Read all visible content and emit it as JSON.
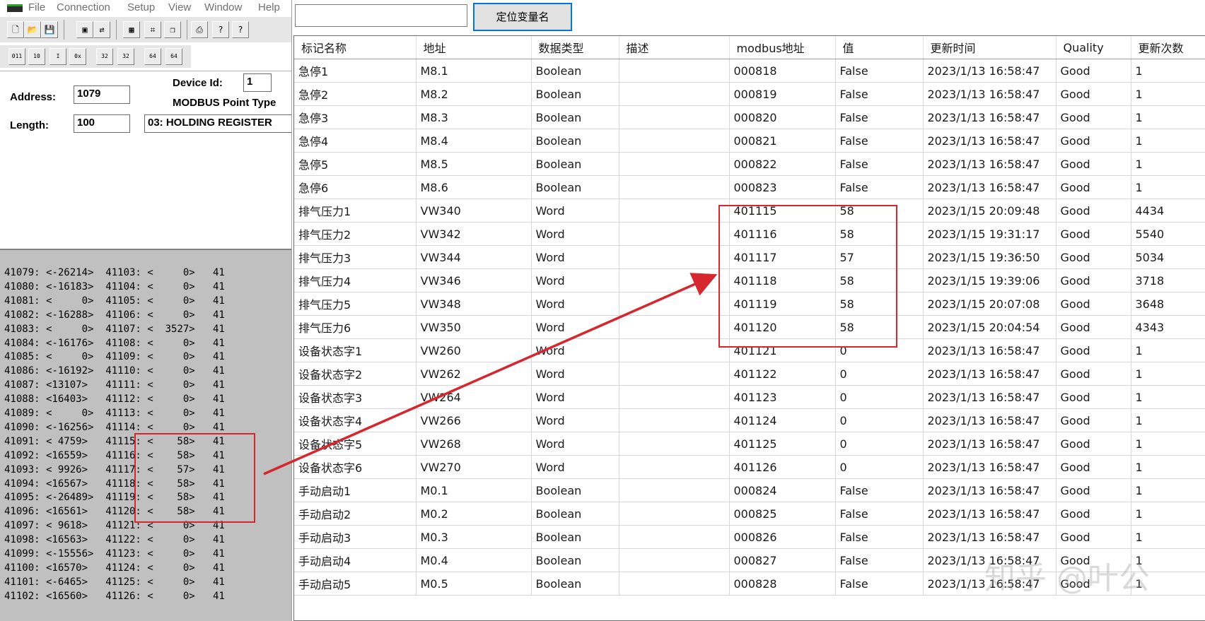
{
  "left_window": {
    "menu": [
      "File",
      "Connection",
      "Setup",
      "View",
      "Window",
      "Help"
    ],
    "toolbar1_icons": [
      {
        "name": "new-file-icon",
        "glyph": "🗋"
      },
      {
        "name": "open-folder-icon",
        "glyph": "📂"
      },
      {
        "name": "save-icon",
        "glyph": "💾"
      },
      {
        "name": "connect-icon",
        "glyph": "▣"
      },
      {
        "name": "disconnect-icon",
        "glyph": "⇄"
      },
      {
        "name": "display-options-icon",
        "glyph": "▦"
      },
      {
        "name": "data-view-icon",
        "glyph": "⌗"
      },
      {
        "name": "tile-windows-icon",
        "glyph": "❐"
      },
      {
        "name": "print-icon",
        "glyph": "⎙"
      },
      {
        "name": "help-icon",
        "glyph": "?"
      },
      {
        "name": "context-help-icon",
        "glyph": "?"
      }
    ],
    "toolbar2_icons": [
      {
        "name": "binary-format-icon",
        "glyph": "011"
      },
      {
        "name": "decimal-format-icon",
        "glyph": "10"
      },
      {
        "name": "integer-format-icon",
        "glyph": "I"
      },
      {
        "name": "hex-format-icon",
        "glyph": "0x"
      },
      {
        "name": "float-format-icon",
        "glyph": "32"
      },
      {
        "name": "reverse-float-icon",
        "glyph": "32"
      },
      {
        "name": "double-format-icon",
        "glyph": "64"
      },
      {
        "name": "reverse-double-icon",
        "glyph": "64"
      }
    ],
    "config": {
      "device_id_label": "Device Id:",
      "device_id": "1",
      "point_type_label": "MODBUS Point Type",
      "address_label": "Address:",
      "address": "1079",
      "length_label": "Length:",
      "length": "100",
      "point_type": "03: HOLDING REGISTER"
    },
    "registers": [
      "41079: <-26214>  41103: <     0>   41",
      "41080: <-16183>  41104: <     0>   41",
      "41081: <     0>  41105: <     0>   41",
      "41082: <-16288>  41106: <     0>   41",
      "41083: <     0>  41107: <  3527>   41",
      "41084: <-16176>  41108: <     0>   41",
      "41085: <     0>  41109: <     0>   41",
      "41086: <-16192>  41110: <     0>   41",
      "41087: <13107>   41111: <     0>   41",
      "41088: <16403>   41112: <     0>   41",
      "41089: <     0>  41113: <     0>   41",
      "41090: <-16256>  41114: <     0>   41",
      "41091: < 4759>   41115: <    58>   41",
      "41092: <16559>   41116: <    58>   41",
      "41093: < 9926>   41117: <    57>   41",
      "41094: <16567>   41118: <    58>   41",
      "41095: <-26489>  41119: <    58>   41",
      "41096: <16561>   41120: <    58>   41",
      "41097: < 9618>   41121: <     0>   41",
      "41098: <16563>   41122: <     0>   41",
      "41099: <-15556>  41123: <     0>   41",
      "41100: <16570>   41124: <     0>   41",
      "41101: <-6465>   41125: <     0>   41",
      "41102: <16560>   41126: <     0>   41"
    ]
  },
  "right_window": {
    "search_value": "",
    "locate_button_label": "定位变量名",
    "columns": [
      "标记名称",
      "地址",
      "数据类型",
      "描述",
      "modbus地址",
      "值",
      "更新时间",
      "Quality",
      "更新次数"
    ],
    "rows": [
      [
        "急停1",
        "M8.1",
        "Boolean",
        "",
        "000818",
        "False",
        "2023/1/13 16:58:47",
        "Good",
        "1"
      ],
      [
        "急停2",
        "M8.2",
        "Boolean",
        "",
        "000819",
        "False",
        "2023/1/13 16:58:47",
        "Good",
        "1"
      ],
      [
        "急停3",
        "M8.3",
        "Boolean",
        "",
        "000820",
        "False",
        "2023/1/13 16:58:47",
        "Good",
        "1"
      ],
      [
        "急停4",
        "M8.4",
        "Boolean",
        "",
        "000821",
        "False",
        "2023/1/13 16:58:47",
        "Good",
        "1"
      ],
      [
        "急停5",
        "M8.5",
        "Boolean",
        "",
        "000822",
        "False",
        "2023/1/13 16:58:47",
        "Good",
        "1"
      ],
      [
        "急停6",
        "M8.6",
        "Boolean",
        "",
        "000823",
        "False",
        "2023/1/13 16:58:47",
        "Good",
        "1"
      ],
      [
        "排气压力1",
        "VW340",
        "Word",
        "",
        "401115",
        "58",
        "2023/1/15 20:09:48",
        "Good",
        "4434"
      ],
      [
        "排气压力2",
        "VW342",
        "Word",
        "",
        "401116",
        "58",
        "2023/1/15 19:31:17",
        "Good",
        "5540"
      ],
      [
        "排气压力3",
        "VW344",
        "Word",
        "",
        "401117",
        "57",
        "2023/1/15 19:36:50",
        "Good",
        "5034"
      ],
      [
        "排气压力4",
        "VW346",
        "Word",
        "",
        "401118",
        "58",
        "2023/1/15 19:39:06",
        "Good",
        "3718"
      ],
      [
        "排气压力5",
        "VW348",
        "Word",
        "",
        "401119",
        "58",
        "2023/1/15 20:07:08",
        "Good",
        "3648"
      ],
      [
        "排气压力6",
        "VW350",
        "Word",
        "",
        "401120",
        "58",
        "2023/1/15 20:04:54",
        "Good",
        "4343"
      ],
      [
        "设备状态字1",
        "VW260",
        "Word",
        "",
        "401121",
        "0",
        "2023/1/13 16:58:47",
        "Good",
        "1"
      ],
      [
        "设备状态字2",
        "VW262",
        "Word",
        "",
        "401122",
        "0",
        "2023/1/13 16:58:47",
        "Good",
        "1"
      ],
      [
        "设备状态字3",
        "VW264",
        "Word",
        "",
        "401123",
        "0",
        "2023/1/13 16:58:47",
        "Good",
        "1"
      ],
      [
        "设备状态字4",
        "VW266",
        "Word",
        "",
        "401124",
        "0",
        "2023/1/13 16:58:47",
        "Good",
        "1"
      ],
      [
        "设备状态字5",
        "VW268",
        "Word",
        "",
        "401125",
        "0",
        "2023/1/13 16:58:47",
        "Good",
        "1"
      ],
      [
        "设备状态字6",
        "VW270",
        "Word",
        "",
        "401126",
        "0",
        "2023/1/13 16:58:47",
        "Good",
        "1"
      ],
      [
        "手动启动1",
        "M0.1",
        "Boolean",
        "",
        "000824",
        "False",
        "2023/1/13 16:58:47",
        "Good",
        "1"
      ],
      [
        "手动启动2",
        "M0.2",
        "Boolean",
        "",
        "000825",
        "False",
        "2023/1/13 16:58:47",
        "Good",
        "1"
      ],
      [
        "手动启动3",
        "M0.3",
        "Boolean",
        "",
        "000826",
        "False",
        "2023/1/13 16:58:47",
        "Good",
        "1"
      ],
      [
        "手动启动4",
        "M0.4",
        "Boolean",
        "",
        "000827",
        "False",
        "2023/1/13 16:58:47",
        "Good",
        "1"
      ],
      [
        "手动启动5",
        "M0.5",
        "Boolean",
        "",
        "000828",
        "False",
        "2023/1/13 16:58:47",
        "Good",
        "1"
      ]
    ]
  },
  "annotation": {
    "color": "#d6262e"
  },
  "watermark": "知乎 @叶公"
}
